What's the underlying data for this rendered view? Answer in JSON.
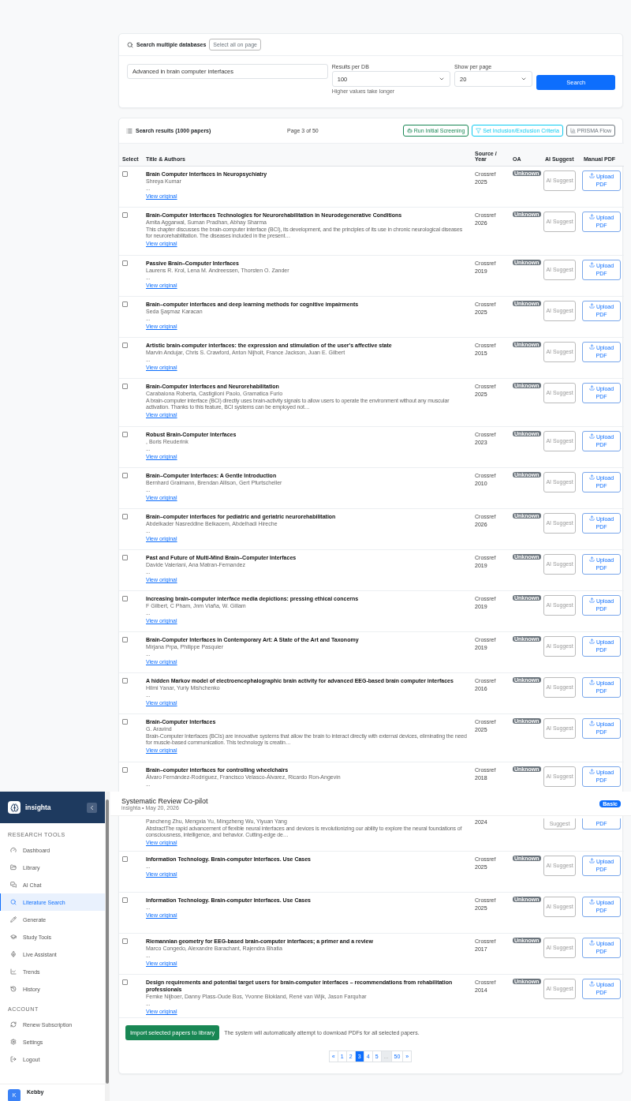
{
  "search_panel": {
    "title": "Search multiple databases",
    "select_all_button": "Select all on page",
    "query": "Advanced in brain computer interfaces",
    "results_per_db": {
      "label": "Results per DB",
      "value": "100",
      "hint": "Higher values take longer"
    },
    "show_per_page": {
      "label": "Show per page",
      "value": "20"
    },
    "search_button": "Search"
  },
  "results": {
    "title": "Search results (1000 papers)",
    "page_info": "Page 3 of 50",
    "actions": [
      {
        "kind": "screening",
        "label": "Run Initial Screening"
      },
      {
        "kind": "criteria",
        "label": "Set Inclusion/Exclusion Criteria"
      },
      {
        "kind": "prisma",
        "label": "PRISMA Flow"
      }
    ],
    "columns": [
      "Select",
      "Title & Authors",
      "Source / Year",
      "OA",
      "AI Suggest",
      "Manual PDF"
    ],
    "rows": [
      {
        "checked": false,
        "title": "Brain Computer Interfaces in Neuropsychiatry",
        "authors": "Shreya Kumar",
        "abstract": "...",
        "link": "View original",
        "source": "Crossref",
        "year": "2025",
        "oa": "Unknown",
        "ai": "AI Suggest",
        "upload": "Upload PDF"
      },
      {
        "checked": false,
        "title": "Brain-Computer Interfaces Technologies for Neurorehabilitation in Neurodegenerative Conditions",
        "authors": "Amita Aggarwal, Suman Pradhan, Abhay Sharma",
        "abstract": "This chapter discusses the brain-computer interface (BCI), its development, and the principles of its use in chronic neurological diseases for neurorehabilitation. The diseases included in the present…",
        "link": "View original",
        "source": "Crossref",
        "year": "2026",
        "oa": "Unknown",
        "ai": "AI Suggest",
        "upload": "Upload PDF"
      },
      {
        "checked": false,
        "title": "Passive Brain–Computer Interfaces",
        "authors": "Laurens R. Krol, Lena M. Andreessen, Thorsten O. Zander",
        "abstract": "...",
        "link": "View original",
        "source": "Crossref",
        "year": "2019",
        "oa": "Unknown",
        "ai": "AI Suggest",
        "upload": "Upload PDF"
      },
      {
        "checked": false,
        "title": "Brain–computer interfaces and deep learning methods for cognitive impairments",
        "authors": "Seda Şaşmaz Karacan",
        "abstract": "...",
        "link": "View original",
        "source": "Crossref",
        "year": "2025",
        "oa": "Unknown",
        "ai": "AI Suggest",
        "upload": "Upload PDF"
      },
      {
        "checked": false,
        "title": "Artistic brain-computer interfaces: the expression and stimulation of the user's affective state",
        "authors": "Marvin Andujar, Chris S. Crawford, Anton Nijholt, France Jackson, Juan E. Gilbert",
        "abstract": "...",
        "link": "View original",
        "source": "Crossref",
        "year": "2015",
        "oa": "Unknown",
        "ai": "AI Suggest",
        "upload": "Upload PDF"
      },
      {
        "checked": false,
        "title": "Brain-Computer Interfaces and Neurorehabilitation",
        "authors": "Carabalona Roberta, Castiglioni Paolo, Gramatica Furio",
        "abstract": "A brain-computer interface (BCI) directly uses brain-activity signals to allow users to operate the environment without any muscular activation. Thanks to this feature, BCI systems can be employed not…",
        "link": "View original",
        "source": "Crossref",
        "year": "2025",
        "oa": "Unknown",
        "ai": "AI Suggest",
        "upload": "Upload PDF"
      },
      {
        "checked": false,
        "title": "Robust Brain-Computer Interfaces",
        "authors": ", Boris Reuderink",
        "abstract": "...",
        "link": "View original",
        "source": "Crossref",
        "year": "2023",
        "oa": "Unknown",
        "ai": "AI Suggest",
        "upload": "Upload PDF"
      },
      {
        "checked": false,
        "title": "Brain–Computer Interfaces: A Gentle Introduction",
        "authors": "Bernhard Graimann, Brendan Allison, Gert Pfurtscheller",
        "abstract": "...",
        "link": "View original",
        "source": "Crossref",
        "year": "2010",
        "oa": "Unknown",
        "ai": "AI Suggest",
        "upload": "Upload PDF"
      },
      {
        "checked": false,
        "title": "Brain–computer interfaces for pediatric and geriatric neurorehabilitation",
        "authors": "Abdelkader Nasreddine Belkacem, Abdelhadi Hireche",
        "abstract": "...",
        "link": "View original",
        "source": "Crossref",
        "year": "2026",
        "oa": "Unknown",
        "ai": "AI Suggest",
        "upload": "Upload PDF"
      },
      {
        "checked": false,
        "title": "Past and Future of Multi-Mind Brain–Computer Interfaces",
        "authors": "Davide Valeriani, Ana Matran-Fernandez",
        "abstract": "...",
        "link": "View original",
        "source": "Crossref",
        "year": "2019",
        "oa": "Unknown",
        "ai": "AI Suggest",
        "upload": "Upload PDF"
      },
      {
        "checked": false,
        "title": "Increasing brain-computer interface media depictions: pressing ethical concerns",
        "authors": "F Gilbert, C Pham, Jnm Viaña, W. Gillam",
        "abstract": "...",
        "link": "View original",
        "source": "Crossref",
        "year": "2019",
        "oa": "Unknown",
        "ai": "AI Suggest",
        "upload": "Upload PDF"
      },
      {
        "checked": false,
        "title": "Brain-Computer Interfaces in Contemporary Art: A State of the Art and Taxonomy",
        "authors": "Mirjana Prpa, Philippe Pasquier",
        "abstract": "...",
        "link": "View original",
        "source": "Crossref",
        "year": "2019",
        "oa": "Unknown",
        "ai": "AI Suggest",
        "upload": "Upload PDF"
      },
      {
        "checked": false,
        "title": "A hidden Markov model of electroencephalographic brain activity for advanced EEG-based brain computer interfaces",
        "authors": "Hilmi Yanar, Yuriy Mishchenko",
        "abstract": "...",
        "link": "View original",
        "source": "Crossref",
        "year": "2016",
        "oa": "Unknown",
        "ai": "AI Suggest",
        "upload": "Upload PDF"
      },
      {
        "checked": false,
        "title": "Brain-Computer Interfaces",
        "authors": "G. Aravind",
        "abstract": "Brain-Computer Interfaces (BCIs) are innovative systems that allow the brain to interact directly with external devices, eliminating the need for muscle-based communication. This technology is creatin…",
        "link": "View original",
        "source": "Crossref",
        "year": "2025",
        "oa": "Unknown",
        "ai": "AI Suggest",
        "upload": "Upload PDF"
      },
      {
        "checked": false,
        "title": "Brain–computer interfaces for controlling wheelchairs",
        "authors": "Álvaro Fernández-Rodríguez, Francisco Velasco-Álvarez, Ricardo Ron-Angevin",
        "abstract": "...",
        "source": "Crossref",
        "year": "2018",
        "oa": "Unknown",
        "ai": "AI Suggest",
        "upload": "Upload PDF"
      },
      {
        "authors": "Pancheng Zhu, Mengxia Yu, Mingzheng Wu, Yiyuan Yang",
        "abstract": "AbstractThe rapid advancement of flexible neural interfaces and devices is revolutionizing our ability to explore the neural foundations of consciousness, intelligence, and behavior. Cutting-edge de…",
        "link": "View original",
        "year": "2024",
        "ai": "Suggest",
        "upload": "PDF"
      },
      {
        "checked": false,
        "title": "Information Technology. Brain-computer Interfaces. Use Cases",
        "abstract": "...",
        "link": "View original",
        "source": "Crossref",
        "year": "2025",
        "oa": "Unknown",
        "ai": "AI Suggest",
        "upload": "Upload PDF"
      },
      {
        "checked": false,
        "title": "Information Technology. Brain-computer Interfaces. Use Cases",
        "abstract": "...",
        "link": "View original",
        "source": "Crossref",
        "year": "2025",
        "oa": "Unknown",
        "ai": "AI Suggest",
        "upload": "Upload PDF"
      },
      {
        "checked": false,
        "title": "Riemannian geometry for EEG-based brain-computer interfaces; a primer and a review",
        "authors": "Marco Congedo, Alexandre Barachant, Rajendra Bhatia",
        "abstract": "...",
        "link": "View original",
        "source": "Crossref",
        "year": "2017",
        "oa": "Unknown",
        "ai": "AI Suggest",
        "upload": "Upload PDF"
      },
      {
        "checked": false,
        "title": "Design requirements and potential target users for brain-computer interfaces – recommendations from rehabilitation professionals",
        "authors": "Femke Nijboer, Danny Plass-Oude Bos, Yvonne Blokland, René van Wijk, Jason Farquhar",
        "abstract": "...",
        "link": "View original",
        "source": "Crossref",
        "year": "2014",
        "oa": "Unknown",
        "ai": "AI Suggest",
        "upload": "Upload PDF"
      }
    ],
    "import_button": "Import selected papers to library",
    "import_note": "The system will automatically attempt to download PDFs for all selected papers.",
    "pagination": [
      {
        "label": "«",
        "selected": false,
        "disabled": false
      },
      {
        "label": "1",
        "selected": false,
        "disabled": false
      },
      {
        "label": "2",
        "selected": false,
        "disabled": false
      },
      {
        "label": "3",
        "selected": true,
        "disabled": false
      },
      {
        "label": "4",
        "selected": false,
        "disabled": false
      },
      {
        "label": "5",
        "selected": false,
        "disabled": false
      },
      {
        "label": "...",
        "selected": false,
        "disabled": true
      },
      {
        "label": "50",
        "selected": false,
        "disabled": false
      },
      {
        "label": "»",
        "selected": false,
        "disabled": false
      }
    ]
  },
  "header": {
    "title": "Systematic Review Co-pilot",
    "subtitle": "insighta • May 20, 2026",
    "plan_badge": "Basic"
  },
  "sidebar": {
    "brand": "insighta",
    "sections": [
      {
        "heading": "RESEARCH TOOLS",
        "items": [
          {
            "label": "Dashboard",
            "selected": false
          },
          {
            "label": "Library",
            "selected": false
          },
          {
            "label": "AI Chat",
            "selected": false
          },
          {
            "label": "Literature Search",
            "selected": true
          },
          {
            "label": "Generate",
            "selected": false
          },
          {
            "label": "Study Tools",
            "selected": false
          },
          {
            "label": "Live Assistant",
            "selected": false
          },
          {
            "label": "Trends",
            "selected": false
          },
          {
            "label": "History",
            "selected": false
          }
        ]
      },
      {
        "heading": "ACCOUNT",
        "items": [
          {
            "label": "Renew Subscription",
            "selected": false
          },
          {
            "label": "Settings",
            "selected": false
          },
          {
            "label": "Logout",
            "selected": false
          }
        ]
      }
    ],
    "user": {
      "avatar": "K",
      "name": "Kebby"
    }
  }
}
